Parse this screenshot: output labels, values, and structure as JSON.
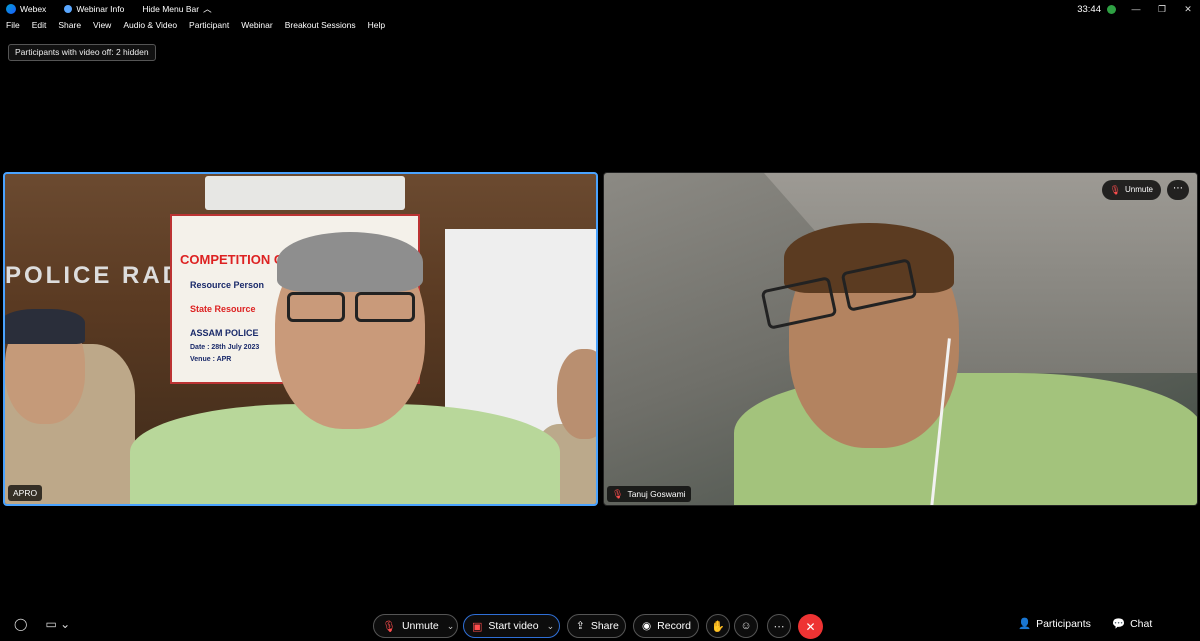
{
  "titlebar": {
    "app_name": "Webex",
    "webinar_info": "Webinar Info",
    "hide_menu_bar": "Hide Menu Bar",
    "time": "33:44"
  },
  "menu": [
    "File",
    "Edit",
    "Share",
    "View",
    "Audio & Video",
    "Participant",
    "Webinar",
    "Breakout Sessions",
    "Help"
  ],
  "hidden_notice": "Participants with video off: 2 hidden",
  "tiles": [
    {
      "name": "APRO",
      "banner_title": "COMPETITION CO",
      "banner_lines": [
        "Resource Person",
        "State Resource",
        "ASSAM POLICE",
        "Date : 28th July 2023",
        "Venue : APR"
      ],
      "wall_text": "POLICE RADIO"
    },
    {
      "name": "Tanuj Goswami",
      "unmute_label": "Unmute"
    }
  ],
  "toolbar": {
    "unmute": "Unmute",
    "start_video": "Start video",
    "share": "Share",
    "record": "Record",
    "participants": "Participants",
    "chat": "Chat"
  },
  "colors": {
    "active_speaker_border": "#4aa3ff",
    "leave_button": "#ee3333",
    "muted_icon": "#ff4d4d"
  }
}
